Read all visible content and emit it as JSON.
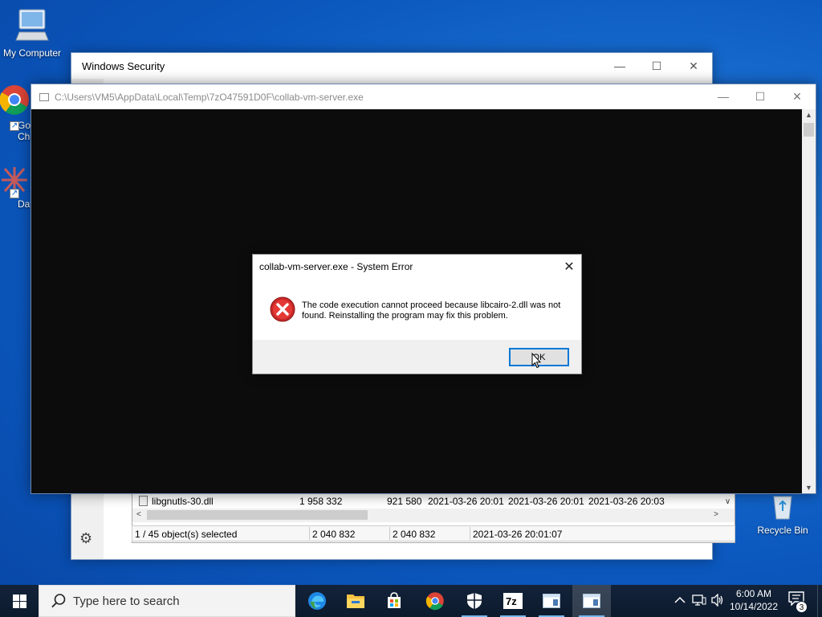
{
  "desktop": {
    "icons": [
      {
        "label": "My Computer"
      },
      {
        "label": "Goo\nChro"
      },
      {
        "label": "DataW"
      },
      {
        "label": "Recycle Bin"
      }
    ]
  },
  "security_window": {
    "title": "Windows Security",
    "file_row": {
      "name": "libgnutls-30.dll",
      "size": "1 958 332",
      "packed": "921 580",
      "modified": "2021-03-26 20:01",
      "created": "2021-03-26 20:01",
      "accessed": "2021-03-26 20:03"
    },
    "status": {
      "selected": "1 / 45 object(s) selected",
      "size": "2 040 832",
      "packed": "2 040 832",
      "modified": "2021-03-26 20:01:07"
    }
  },
  "console_window": {
    "title": "C:\\Users\\VM5\\AppData\\Local\\Temp\\7zO47591D0F\\collab-vm-server.exe"
  },
  "error_dialog": {
    "title": "collab-vm-server.exe - System Error",
    "message": "The code execution cannot proceed because libcairo-2.dll was not found. Reinstalling the program may fix this problem.",
    "ok_label": "OK"
  },
  "taskbar": {
    "search_placeholder": "Type here to search",
    "apps": [
      "edge-icon",
      "file-explorer-icon",
      "store-icon",
      "chrome-icon",
      "security-icon",
      "7zip-icon",
      "window-app-icon",
      "window-app-icon"
    ],
    "time": "6:00 AM",
    "date": "10/14/2022",
    "notification_count": "3"
  },
  "colors": {
    "accent": "#0078d7",
    "error_red": "#d32f2f"
  }
}
